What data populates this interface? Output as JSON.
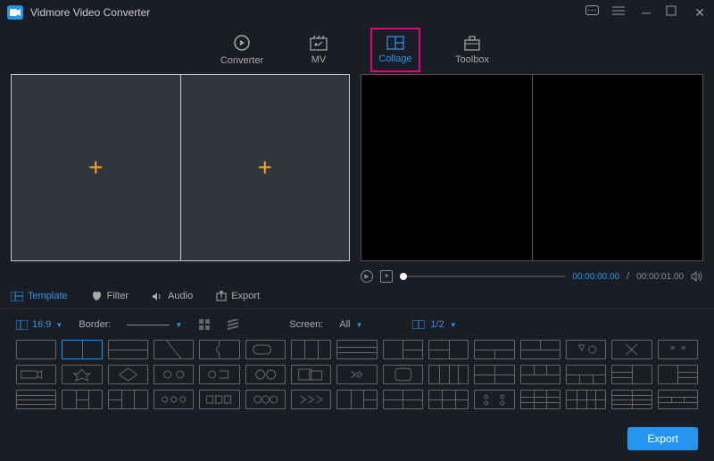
{
  "app": {
    "title": "Vidmore Video Converter"
  },
  "tabs": {
    "converter": "Converter",
    "mv": "MV",
    "collage": "Collage",
    "toolbox": "Toolbox"
  },
  "subtabs": {
    "template": "Template",
    "filter": "Filter",
    "audio": "Audio",
    "export": "Export"
  },
  "options": {
    "aspect": "16:9",
    "border_label": "Border:",
    "screen_label": "Screen:",
    "screen_value": "All",
    "split_value": "1/2"
  },
  "player": {
    "current": "00:00:00.00",
    "duration": "00:00:01.00"
  },
  "footer": {
    "export": "Export"
  }
}
